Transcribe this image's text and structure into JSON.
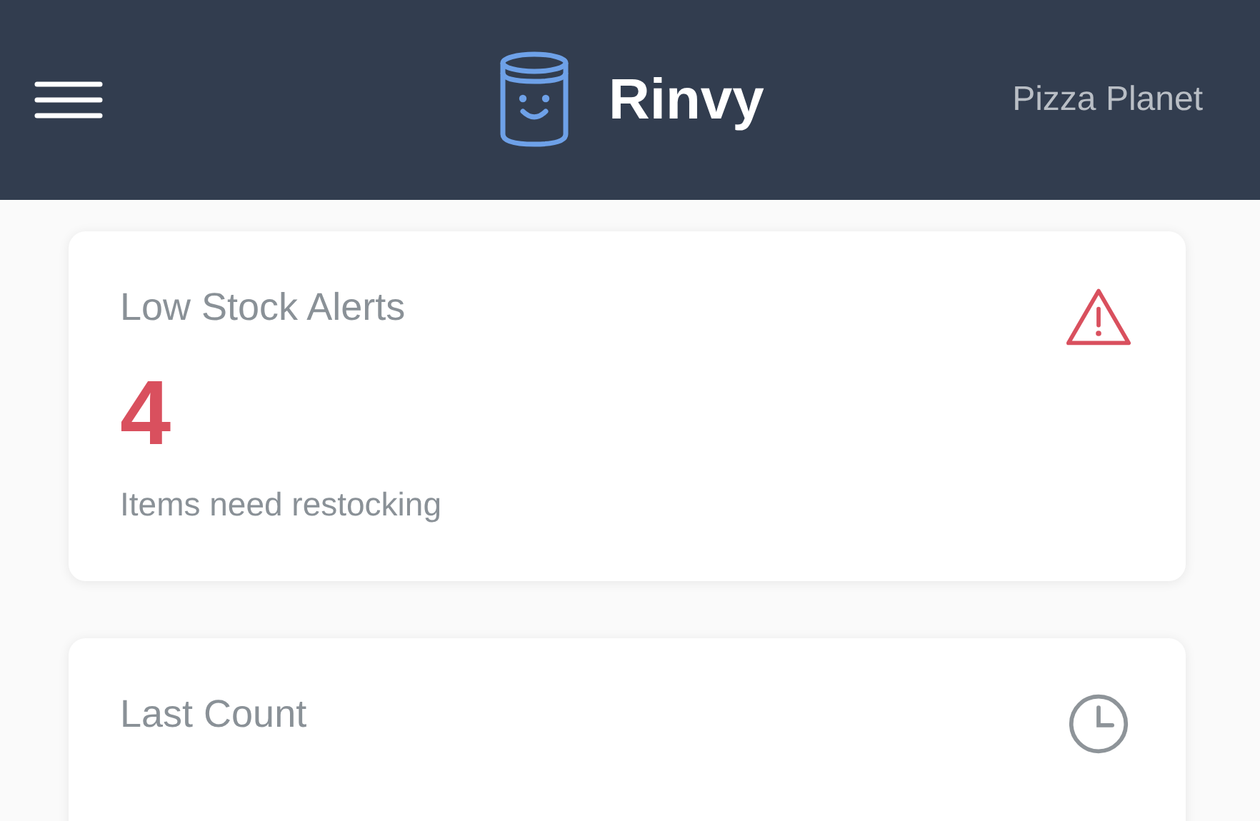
{
  "header": {
    "brand": "Rinvy",
    "location": "Pizza Planet"
  },
  "cards": [
    {
      "kind": "alert",
      "title": "Low Stock Alerts",
      "value": "4",
      "caption": "Items need restocking"
    },
    {
      "kind": "clock",
      "title": "Last Count"
    }
  ]
}
